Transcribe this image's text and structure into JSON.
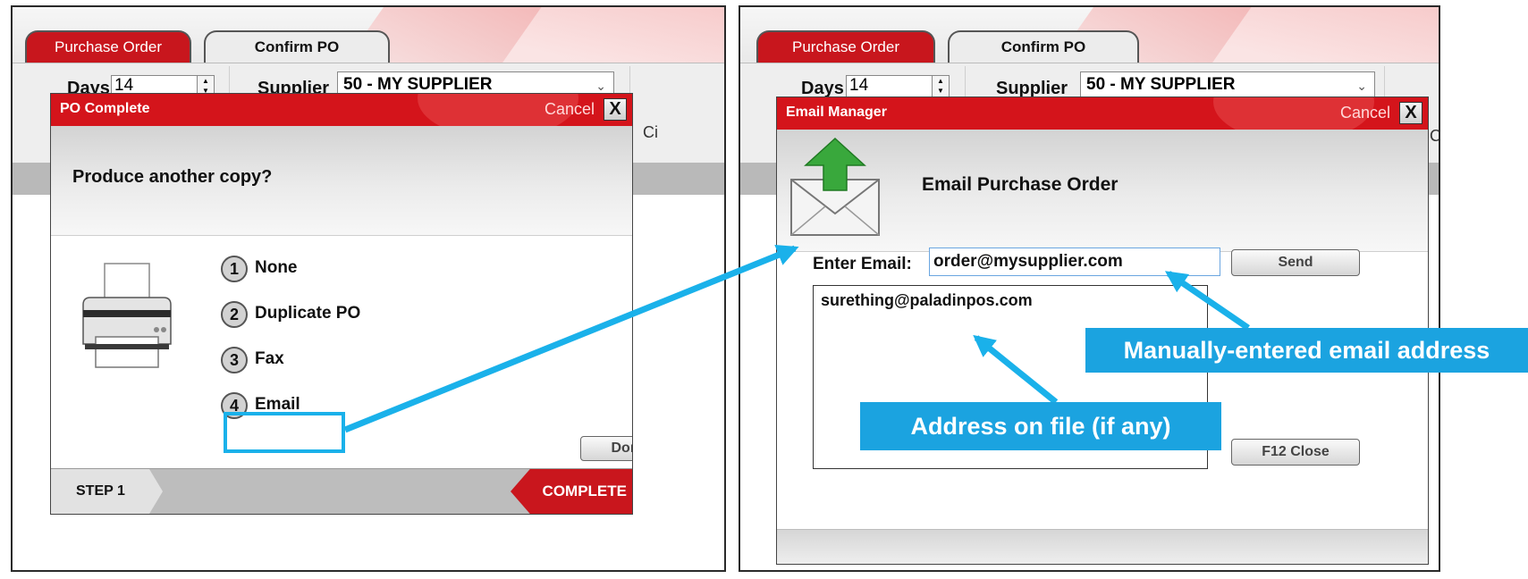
{
  "colors": {
    "accent_red": "#c8161d",
    "callout_blue": "#1ba3e0",
    "highlight_blue": "#1ab1ea"
  },
  "left": {
    "tabs": [
      "Purchase Order",
      "Confirm PO"
    ],
    "days_label": "Days",
    "days_value": "14",
    "supplier_label": "Supplier",
    "supplier_value": "50 - MY SUPPLIER",
    "peek_text": "Ci",
    "dialog": {
      "title": "PO Complete",
      "cancel": "Cancel",
      "close_glyph": "X",
      "question": "Produce another copy?",
      "icon": "printer-icon",
      "options": [
        {
          "num": "1",
          "label": "None"
        },
        {
          "num": "2",
          "label": "Duplicate PO"
        },
        {
          "num": "3",
          "label": "Fax"
        },
        {
          "num": "4",
          "label": "Email"
        }
      ],
      "done": "Done",
      "step": "STEP 1",
      "complete": "COMPLETE"
    }
  },
  "right": {
    "tabs": [
      "Purchase Order",
      "Confirm PO"
    ],
    "days_label": "Days",
    "days_value": "14",
    "supplier_label": "Supplier",
    "supplier_value": "50 - MY SUPPLIER",
    "peek_text": "C",
    "dialog": {
      "title": "Email Manager",
      "cancel": "Cancel",
      "close_glyph": "X",
      "heading": "Email Purchase Order",
      "icon": "email-upload-icon",
      "email_label": "Enter Email:",
      "email_value": "order@mysupplier.com",
      "address_on_file": "surething@paladinpos.com",
      "send": "Send",
      "close_btn": "F12 Close"
    }
  },
  "callouts": {
    "manual": "Manually-entered email address",
    "on_file": "Address on file (if any)"
  }
}
